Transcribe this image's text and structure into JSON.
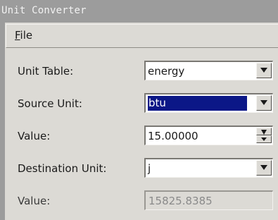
{
  "window": {
    "title": "Unit Converter"
  },
  "menu": {
    "file_label": "File",
    "file_mnemonic": "F",
    "file_rest": "ile"
  },
  "form": {
    "unit_table": {
      "label": "Unit Table:",
      "value": "energy"
    },
    "source_unit": {
      "label": "Source Unit:",
      "value": "btu"
    },
    "value": {
      "label": "Value:",
      "value": "15.00000"
    },
    "destination_unit": {
      "label": "Destination Unit:",
      "value": "j"
    },
    "result": {
      "label": "Value:",
      "value": "15825.8385"
    }
  },
  "colors": {
    "selection": "#0b1787",
    "background": "#dcdad5",
    "titlebar": "#9c9c9c"
  }
}
